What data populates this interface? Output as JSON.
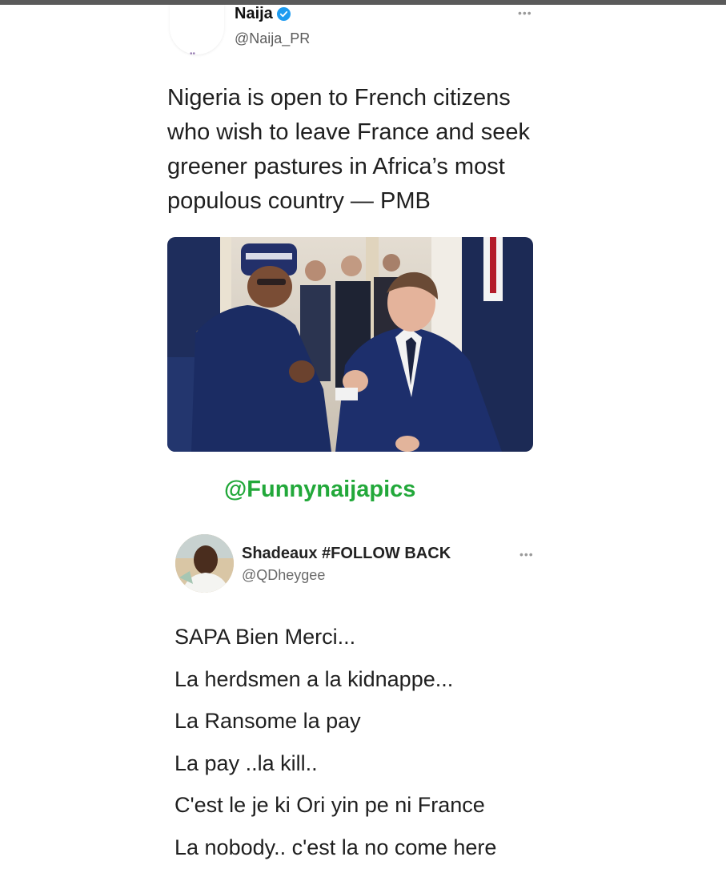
{
  "tweet1": {
    "author_name": "Naija",
    "author_handle": "@Naija_PR",
    "verified": true,
    "more_label": "•••",
    "text": "Nigeria is open to French citizens who wish to leave France and seek greener pastures in Africa’s most populous country — PMB"
  },
  "watermark": "@Funnynaijapics",
  "tweet2": {
    "author_name": "Shadeaux #FOLLOW BACK",
    "author_handle": "@QDheygee",
    "more_label": "•••",
    "lines": [
      "SAPA Bien Merci...",
      "La herdsmen a la kidnappe...",
      "La Ransome la pay",
      "La pay ..la kill..",
      "C'est le je ki Ori yin pe ni France",
      "La nobody.. c'est la no come here"
    ]
  },
  "colors": {
    "verified_badge": "#1d9bf0",
    "watermark": "#22a83a",
    "suit_blue": "#1b2f6e"
  },
  "icons": {
    "verified": "verified-badge-icon",
    "more": "more-options-icon"
  }
}
